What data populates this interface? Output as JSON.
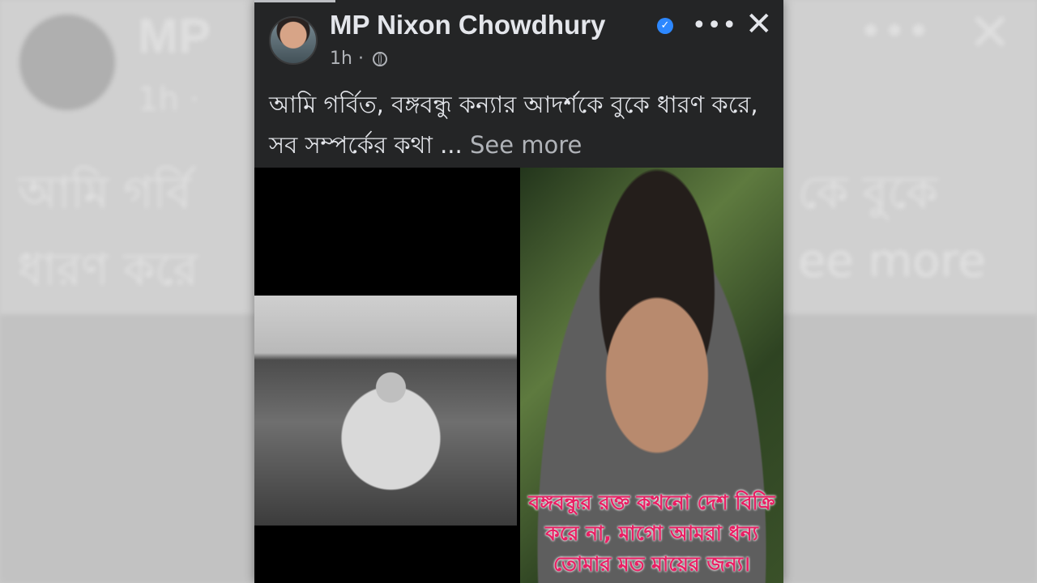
{
  "post": {
    "author": "MP Nixon Chowdhury",
    "time": "1h",
    "separator": "·",
    "text": "আমি গর্বিত, বঙ্গবন্ধু কন্যার আদর্শকে বুকে ধারণ করে, সব সম্পর্কের কথা ...",
    "see_more": "See more",
    "image_caption": "বঙ্গবন্ধুর রক্ত কখনো দেশ বিক্রি করে না, মাগো আমরা ধন্য তোমার মত মায়ের জন্য।"
  },
  "icons": {
    "verified": "verified-badge-icon",
    "privacy": "globe-icon",
    "more": "more-options-icon",
    "close": "close-icon"
  },
  "colors": {
    "card_bg": "#242526",
    "text_primary": "#e4e6eb",
    "text_secondary": "#b0b3b8",
    "verified_blue": "#2d88ff",
    "caption_pink": "#e91e63"
  },
  "background_blur": {
    "name": "MP",
    "time": "1h ·",
    "text_line1": "আমি গর্বি",
    "text_line2": "ধারণ করে",
    "text_right1": "কে বুকে",
    "text_right2": "ee more"
  }
}
